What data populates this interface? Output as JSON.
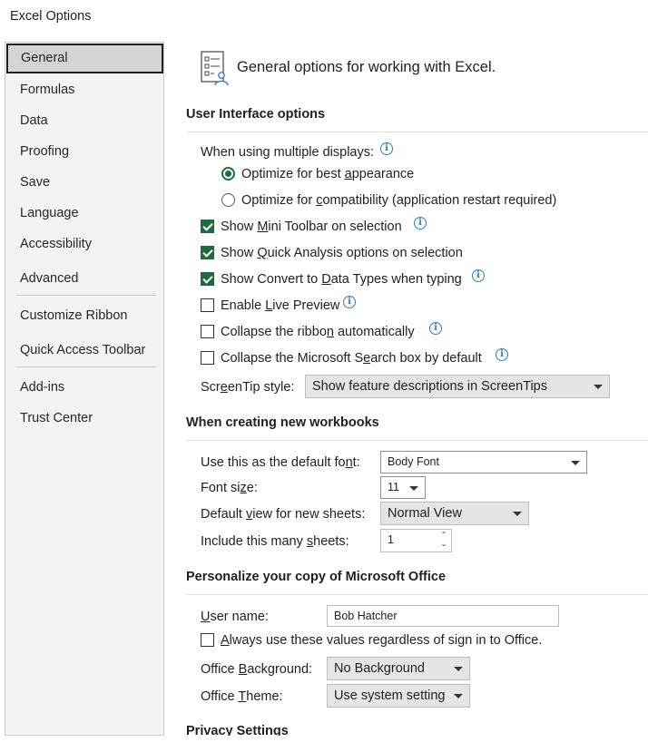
{
  "window": {
    "title": "Excel Options"
  },
  "sidebar": {
    "items": [
      {
        "label": "General"
      },
      {
        "label": "Formulas"
      },
      {
        "label": "Data"
      },
      {
        "label": "Proofing"
      },
      {
        "label": "Save"
      },
      {
        "label": "Language"
      },
      {
        "label": "Accessibility"
      },
      {
        "label": "Advanced"
      },
      {
        "label": "Customize Ribbon"
      },
      {
        "label": "Quick Access Toolbar"
      },
      {
        "label": "Add-ins"
      },
      {
        "label": "Trust Center"
      }
    ],
    "selected": "General"
  },
  "header": {
    "title": "General options for working with Excel.",
    "icon": "general-options-icon"
  },
  "ui_options": {
    "heading": "User Interface options",
    "multiple_displays_label": "When using multiple displays:",
    "radio_best": {
      "pre": "Optimize for best ",
      "ul": "a",
      "post": "ppearance",
      "checked": true
    },
    "radio_compat": {
      "pre": "Optimize for ",
      "ul": "c",
      "post": "ompatibility (application restart required)",
      "checked": false
    },
    "mini_toolbar": {
      "pre": "Show ",
      "ul": "M",
      "post": "ini Toolbar on selection",
      "checked": true
    },
    "quick_analysis": {
      "pre": "Show ",
      "ul": "Q",
      "post": "uick Analysis options on selection",
      "checked": true
    },
    "convert_data_types": {
      "pre": "Show Convert to ",
      "ul": "D",
      "post": "ata Types when typing",
      "checked": true
    },
    "live_preview": {
      "pre": "Enable ",
      "ul": "L",
      "post": "ive Preview",
      "checked": false
    },
    "collapse_ribbon": {
      "pre": "Collapse the ribbo",
      "ul": "n",
      "post": " automatically",
      "checked": false
    },
    "collapse_search": {
      "pre": "Collapse the Microsoft S",
      "ul": "e",
      "post": "arch box by default",
      "checked": false
    },
    "screentip_label": {
      "pre": "Scr",
      "ul": "e",
      "post": "enTip style:"
    },
    "screentip_value": "Show feature descriptions in ScreenTips"
  },
  "new_workbooks": {
    "heading": "When creating new workbooks",
    "default_font_label": {
      "pre": "Use this as the default fo",
      "ul": "n",
      "post": "t:"
    },
    "default_font_value": "Body Font",
    "font_size_label": {
      "pre": "Font si",
      "ul": "z",
      "post": "e:"
    },
    "font_size_value": "11",
    "default_view_label": {
      "pre": "Default ",
      "ul": "v",
      "post": "iew for new sheets:"
    },
    "default_view_value": "Normal View",
    "sheets_label": {
      "pre": "Include this many ",
      "ul": "s",
      "post": "heets:"
    },
    "sheets_value": "1"
  },
  "personalize": {
    "heading": "Personalize your copy of Microsoft Office",
    "username_label": {
      "pre": "",
      "ul": "U",
      "post": "ser name:"
    },
    "username_value": "Bob Hatcher",
    "always_use": {
      "pre": "",
      "ul": "A",
      "post": "lways use these values regardless of sign in to Office.",
      "checked": false
    },
    "background_label": {
      "pre": "Office ",
      "ul": "B",
      "post": "ackground:"
    },
    "background_value": "No Background",
    "theme_label": {
      "pre": "Office ",
      "ul": "T",
      "post": "heme:"
    },
    "theme_value": "Use system setting"
  },
  "privacy": {
    "heading": "Privacy Settings"
  },
  "colors": {
    "accent_green": "#1d6c3e",
    "info_blue": "#2b7dc6",
    "sidebar_bg": "#f3f3f3"
  }
}
